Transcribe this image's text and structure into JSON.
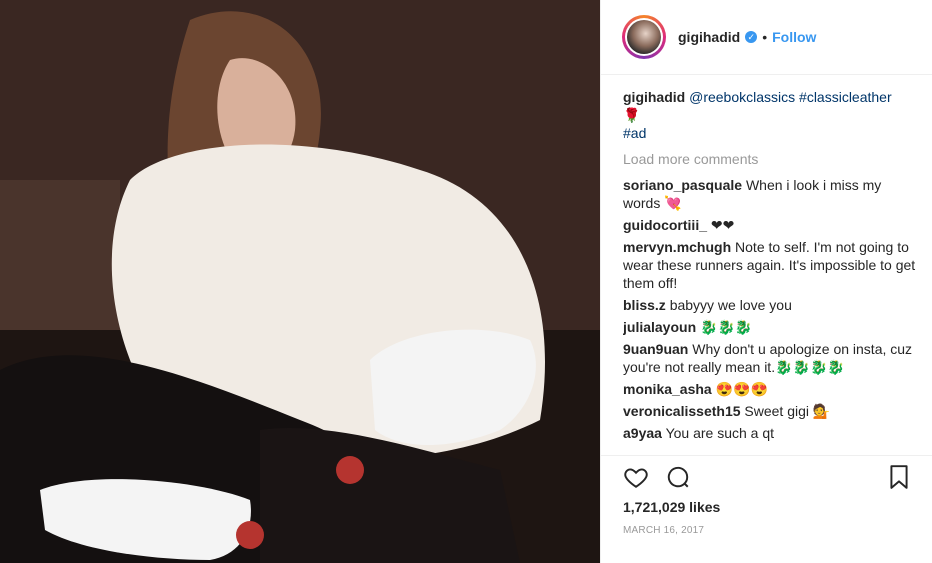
{
  "header": {
    "username": "gigihadid",
    "separator": "•",
    "follow_label": "Follow"
  },
  "caption": {
    "username": "gigihadid",
    "mention": "@reebokclassics",
    "hashtag": "#classicleather",
    "emoji": "🌹",
    "ad_tag": "#ad"
  },
  "load_more_label": "Load more comments",
  "comments": [
    {
      "user": "soriano_pasquale",
      "text": "When i look i miss my words 💘"
    },
    {
      "user": "guidocortiii_",
      "text": "❤❤"
    },
    {
      "user": "mervyn.mchugh",
      "text": "Note to self. I'm not going to wear these runners again. It's impossible to get them off!"
    },
    {
      "user": "bliss.z",
      "text": "babyyy we love you"
    },
    {
      "user": "julialayoun",
      "text": "🐉🐉🐉"
    },
    {
      "user": "9uan9uan",
      "text": "Why don't u apologize on insta, cuz you're not really mean it.🐉🐉🐉🐉"
    },
    {
      "user": "monika_asha",
      "text": "😍😍😍"
    },
    {
      "user": "veronicalisseth15",
      "text": "Sweet gigi 💁"
    },
    {
      "user": "a9yaa",
      "text": "You are such a qt"
    }
  ],
  "likes_text": "1,721,029 likes",
  "date_text": "MARCH 16, 2017",
  "icons": {
    "verified": "verified-badge-icon",
    "like": "heart-icon",
    "comment": "comment-icon",
    "save": "bookmark-icon"
  },
  "colors": {
    "link": "#003569",
    "follow": "#3897f0",
    "muted": "#999999"
  }
}
